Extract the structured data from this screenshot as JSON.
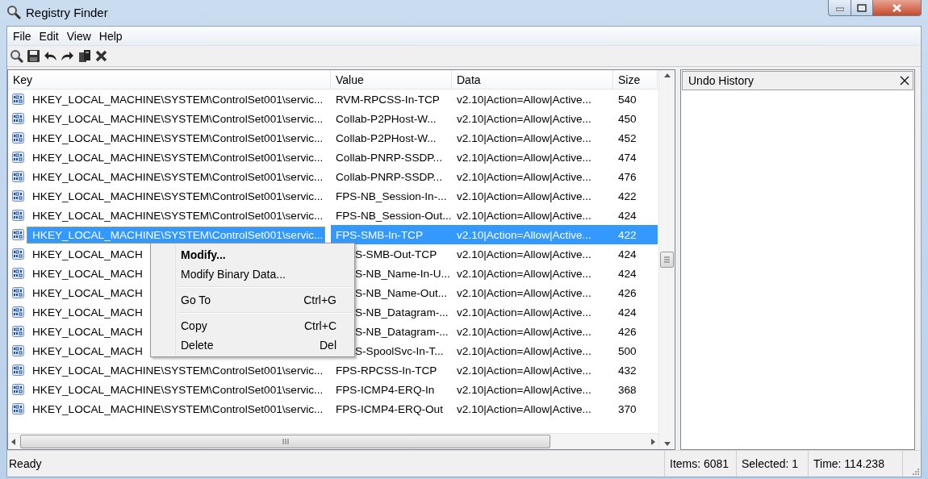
{
  "window": {
    "title": "Registry Finder"
  },
  "menu_bar": [
    "File",
    "Edit",
    "View",
    "Help"
  ],
  "table": {
    "columns": [
      "Key",
      "Value",
      "Data",
      "Size"
    ],
    "rows": [
      {
        "key": "HKEY_LOCAL_MACHINE\\SYSTEM\\ControlSet001\\servic...",
        "value": "RVM-RPCSS-In-TCP",
        "data": "v2.10|Action=Allow|Active...",
        "size": "540",
        "selected": false,
        "under_menu": false
      },
      {
        "key": "HKEY_LOCAL_MACHINE\\SYSTEM\\ControlSet001\\servic...",
        "value": "Collab-P2PHost-W...",
        "data": "v2.10|Action=Allow|Active...",
        "size": "450",
        "selected": false,
        "under_menu": false
      },
      {
        "key": "HKEY_LOCAL_MACHINE\\SYSTEM\\ControlSet001\\servic...",
        "value": "Collab-P2PHost-W...",
        "data": "v2.10|Action=Allow|Active...",
        "size": "452",
        "selected": false,
        "under_menu": false
      },
      {
        "key": "HKEY_LOCAL_MACHINE\\SYSTEM\\ControlSet001\\servic...",
        "value": "Collab-PNRP-SSDP...",
        "data": "v2.10|Action=Allow|Active...",
        "size": "474",
        "selected": false,
        "under_menu": false
      },
      {
        "key": "HKEY_LOCAL_MACHINE\\SYSTEM\\ControlSet001\\servic...",
        "value": "Collab-PNRP-SSDP...",
        "data": "v2.10|Action=Allow|Active...",
        "size": "476",
        "selected": false,
        "under_menu": false
      },
      {
        "key": "HKEY_LOCAL_MACHINE\\SYSTEM\\ControlSet001\\servic...",
        "value": "FPS-NB_Session-In-...",
        "data": "v2.10|Action=Allow|Active...",
        "size": "422",
        "selected": false,
        "under_menu": false
      },
      {
        "key": "HKEY_LOCAL_MACHINE\\SYSTEM\\ControlSet001\\servic...",
        "value": "FPS-NB_Session-Out...",
        "data": "v2.10|Action=Allow|Active...",
        "size": "424",
        "selected": false,
        "under_menu": false
      },
      {
        "key": "HKEY_LOCAL_MACHINE\\SYSTEM\\ControlSet001\\servic...",
        "value": "FPS-SMB-In-TCP",
        "data": "v2.10|Action=Allow|Active...",
        "size": "422",
        "selected": true,
        "under_menu": false
      },
      {
        "key": "HKEY_LOCAL_MACH",
        "value": "S-SMB-Out-TCP",
        "data": "v2.10|Action=Allow|Active...",
        "size": "424",
        "selected": false,
        "under_menu": true
      },
      {
        "key": "HKEY_LOCAL_MACH",
        "value": "S-NB_Name-In-U...",
        "data": "v2.10|Action=Allow|Active...",
        "size": "424",
        "selected": false,
        "under_menu": true
      },
      {
        "key": "HKEY_LOCAL_MACH",
        "value": "S-NB_Name-Out...",
        "data": "v2.10|Action=Allow|Active...",
        "size": "426",
        "selected": false,
        "under_menu": true
      },
      {
        "key": "HKEY_LOCAL_MACH",
        "value": "S-NB_Datagram-...",
        "data": "v2.10|Action=Allow|Active...",
        "size": "424",
        "selected": false,
        "under_menu": true
      },
      {
        "key": "HKEY_LOCAL_MACH",
        "value": "S-NB_Datagram-...",
        "data": "v2.10|Action=Allow|Active...",
        "size": "426",
        "selected": false,
        "under_menu": true
      },
      {
        "key": "HKEY_LOCAL_MACH",
        "value": "S-SpoolSvc-In-T...",
        "data": "v2.10|Action=Allow|Active...",
        "size": "500",
        "selected": false,
        "under_menu": true
      },
      {
        "key": "HKEY_LOCAL_MACHINE\\SYSTEM\\ControlSet001\\servic...",
        "value": "FPS-RPCSS-In-TCP",
        "data": "v2.10|Action=Allow|Active...",
        "size": "432",
        "selected": false,
        "under_menu": false
      },
      {
        "key": "HKEY_LOCAL_MACHINE\\SYSTEM\\ControlSet001\\servic...",
        "value": "FPS-ICMP4-ERQ-In",
        "data": "v2.10|Action=Allow|Active...",
        "size": "368",
        "selected": false,
        "under_menu": false
      },
      {
        "key": "HKEY_LOCAL_MACHINE\\SYSTEM\\ControlSet001\\servic...",
        "value": "FPS-ICMP4-ERQ-Out",
        "data": "v2.10|Action=Allow|Active...",
        "size": "370",
        "selected": false,
        "under_menu": false
      }
    ]
  },
  "context_menu": [
    {
      "kind": "item",
      "label": "Modify...",
      "default": true
    },
    {
      "kind": "item",
      "label": "Modify Binary Data...",
      "default": false
    },
    {
      "kind": "separator"
    },
    {
      "kind": "item",
      "label": "Go To",
      "shortcut": "Ctrl+G",
      "default": false
    },
    {
      "kind": "separator"
    },
    {
      "kind": "item",
      "label": "Copy",
      "shortcut": "Ctrl+C",
      "default": false
    },
    {
      "kind": "item",
      "label": "Delete",
      "shortcut": "Del",
      "default": false
    }
  ],
  "undo_panel": {
    "title": "Undo History"
  },
  "status_bar": {
    "status": "Ready",
    "items": "Items: 6081",
    "selected": "Selected: 1",
    "time": "Time: 114.238"
  }
}
